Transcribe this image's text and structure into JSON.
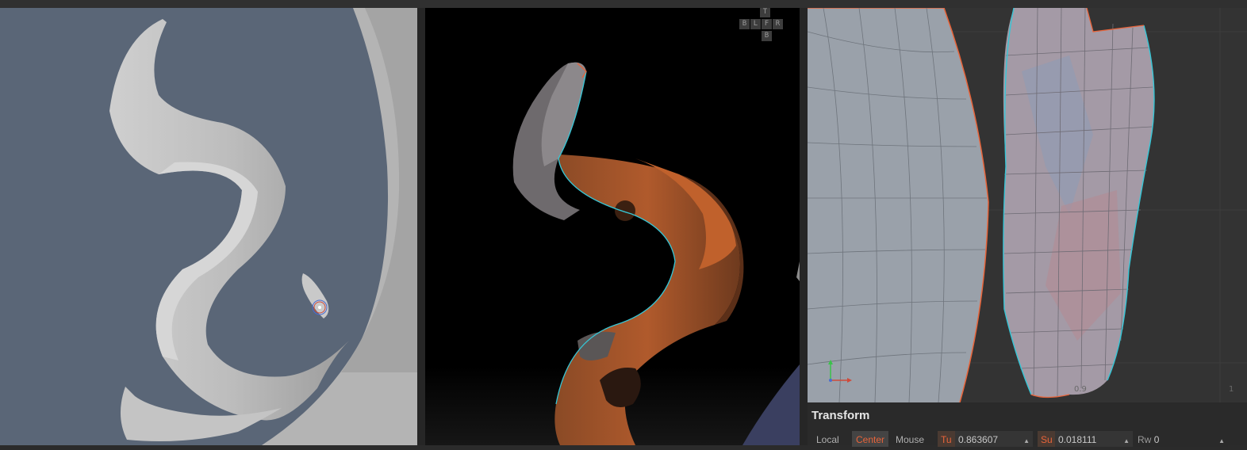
{
  "app": {
    "viewports": [
      "perspective-view",
      "textured-view",
      "uv-editor"
    ]
  },
  "viewcube": {
    "top": "T",
    "back": "B",
    "left": "L",
    "front": "F",
    "right": "R",
    "bottom": "B"
  },
  "uv_editor": {
    "tick_left": "0.9",
    "tick_right": "1"
  },
  "transform": {
    "title": "Transform",
    "local_label": "Local",
    "center_label": "Center",
    "mouse_label": "Mouse",
    "tu_label": "Tu",
    "tu_value": "0.863607",
    "su_label": "Su",
    "su_value": "0.018111",
    "rw_label": "Rw",
    "rw_value": "0"
  },
  "colors": {
    "accent": "#e8643a",
    "uv_seam": "#36c6d6",
    "viewport_bg": "#5a6677"
  }
}
